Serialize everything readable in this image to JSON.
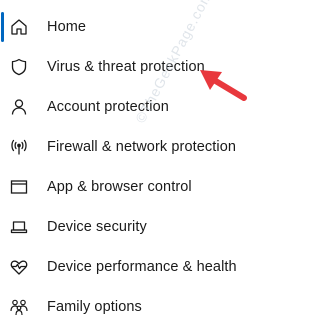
{
  "nav": {
    "items": [
      {
        "label": "Home",
        "icon": "home-icon"
      },
      {
        "label": "Virus & threat protection",
        "icon": "shield-icon"
      },
      {
        "label": "Account protection",
        "icon": "person-icon"
      },
      {
        "label": "Firewall & network protection",
        "icon": "wifi-antenna-icon"
      },
      {
        "label": "App & browser control",
        "icon": "window-icon"
      },
      {
        "label": "Device security",
        "icon": "laptop-icon"
      },
      {
        "label": "Device performance & health",
        "icon": "heart-pulse-icon"
      },
      {
        "label": "Family options",
        "icon": "family-icon"
      }
    ],
    "selected_index": 0
  },
  "watermark": "©TheGeekPage.com",
  "colors": {
    "accent": "#0067c0",
    "arrow": "#e8383d",
    "text": "#1a1a1a"
  }
}
